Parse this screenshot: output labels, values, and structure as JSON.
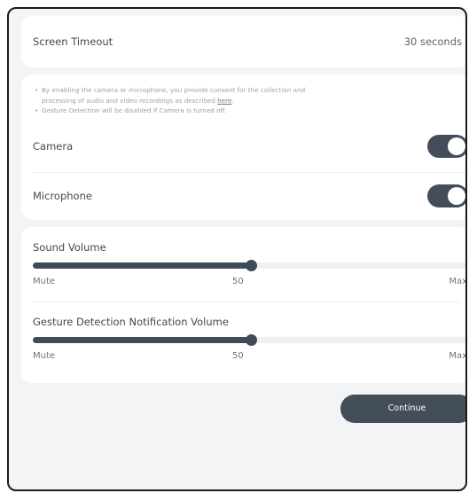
{
  "screen_timeout": {
    "label": "Screen Timeout",
    "value": "30 seconds"
  },
  "consent": {
    "note_1_line_1": "By enabling the camera or microphone, you provide consent for the collection and",
    "note_1_line_2_prefix": "processing of audio and video recordings as described ",
    "note_1_link": "here",
    "note_1_line_2_suffix": ".",
    "note_2": "Gesture Detection will be disabled if Camera is turned off.",
    "bullet": "•"
  },
  "camera": {
    "label": "Camera",
    "enabled": true
  },
  "microphone": {
    "label": "Microphone",
    "enabled": true
  },
  "sound_volume": {
    "label": "Sound Volume",
    "value": 50,
    "min_label": "Mute",
    "value_label": "50",
    "max_label": "Max"
  },
  "gesture_volume": {
    "label": "Gesture Detection Notification Volume",
    "value": 50,
    "min_label": "Mute",
    "value_label": "50",
    "max_label": "Max"
  },
  "continue_label": "Continue",
  "colors": {
    "accent": "#434e5a",
    "track": "#eef0f3",
    "background": "#f3f4f6"
  }
}
